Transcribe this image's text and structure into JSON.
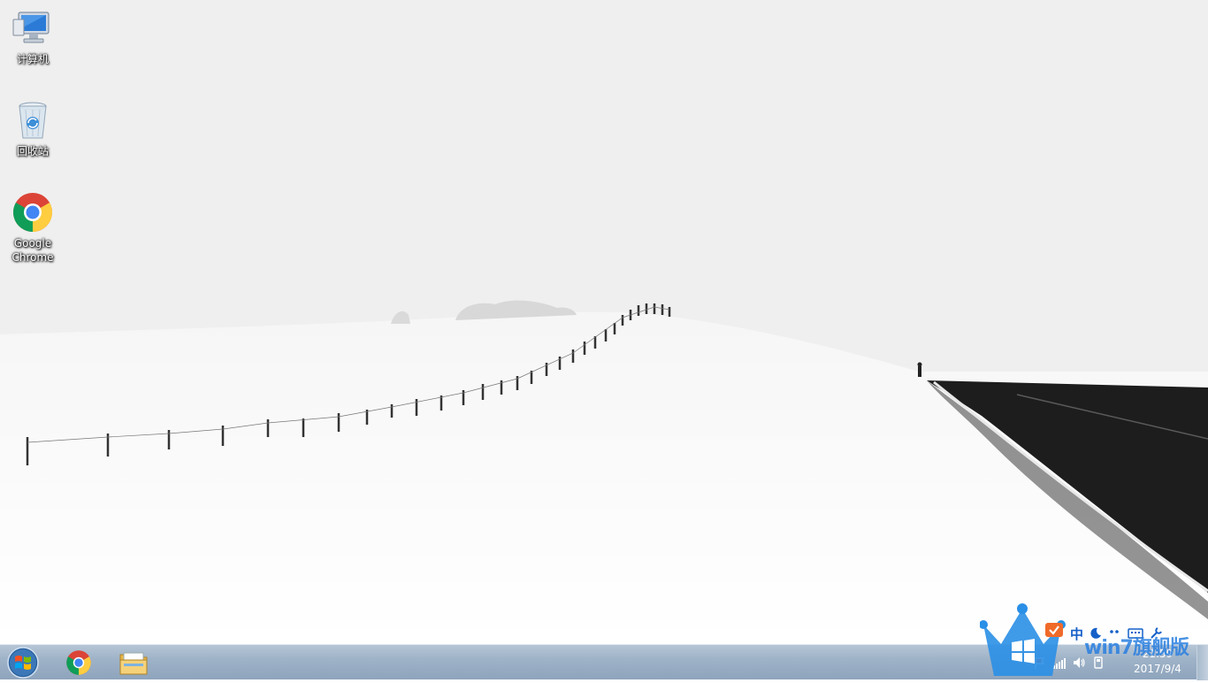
{
  "desktop": {
    "icons": [
      {
        "label": "计算机",
        "icon": "computer-icon"
      },
      {
        "label": "回收站",
        "icon": "recycle-bin-icon"
      },
      {
        "label": "Google Chrome",
        "icon": "chrome-icon"
      }
    ]
  },
  "taskbar": {
    "start": {
      "icon": "windows-start-icon"
    },
    "apps": [
      {
        "name": "Google Chrome",
        "icon": "chrome-icon"
      },
      {
        "name": "Windows Explorer",
        "icon": "folder-icon"
      }
    ],
    "tray": {
      "ime": {
        "label": "中",
        "icons": [
          "moon-icon",
          "punctuation-icon",
          "keyboard-icon",
          "tools-icon"
        ]
      },
      "icons": [
        "flag-icon",
        "network-icon",
        "volume-icon",
        "usb-icon"
      ],
      "clock": {
        "time": "21:59",
        "date": "2017/9/4"
      }
    }
  },
  "watermark": {
    "text": "win7旗舰版",
    "icon": "crown-windows-logo-icon"
  },
  "colors": {
    "taskbar": "#9fb3c8",
    "wallpaper_sky": "#efefef",
    "road": "#1a1a1a",
    "watermark_blue": "#2a7fe0"
  }
}
